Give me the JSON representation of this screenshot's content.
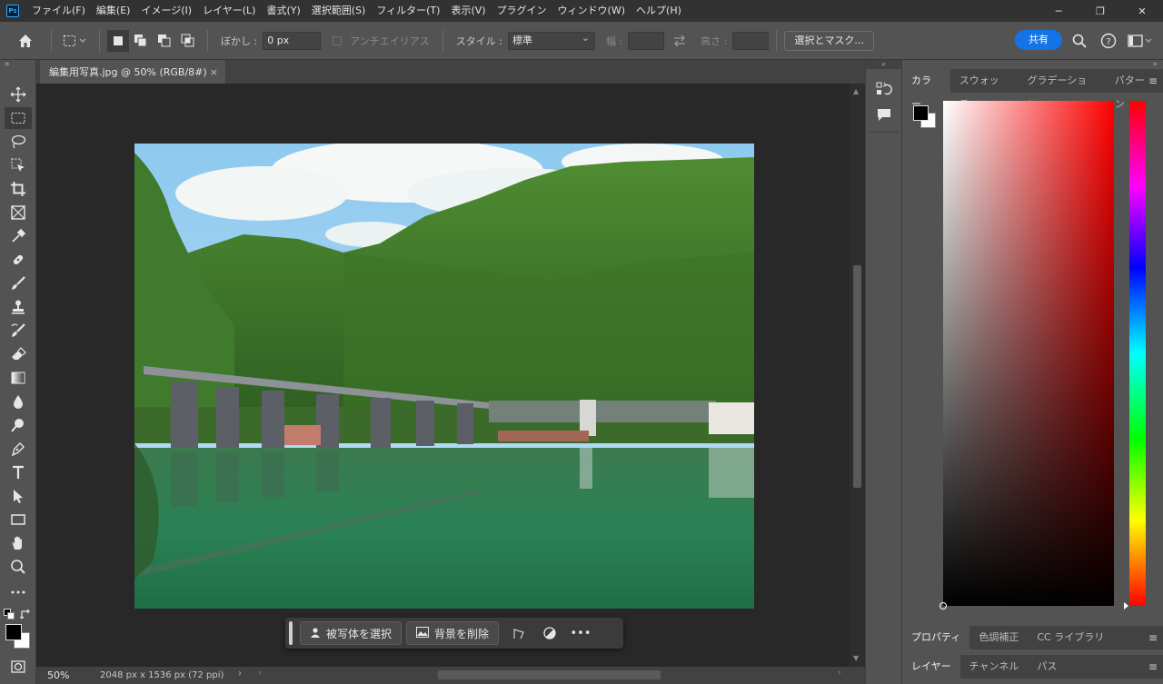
{
  "app": {
    "logo": "Ps"
  },
  "menu": {
    "items": [
      "ファイル(F)",
      "編集(E)",
      "イメージ(I)",
      "レイヤー(L)",
      "書式(Y)",
      "選択範囲(S)",
      "フィルター(T)",
      "表示(V)",
      "プラグイン",
      "ウィンドウ(W)",
      "ヘルプ(H)"
    ]
  },
  "window_controls": {
    "minimize": "─",
    "restore": "❐",
    "close": "✕"
  },
  "options": {
    "feather_label": "ぼかし :",
    "feather_value": "0 px",
    "antialias_label": "アンチエイリアス",
    "style_label": "スタイル :",
    "style_value": "標準",
    "width_label": "幅 :",
    "height_label": "高さ :",
    "select_mask_label": "選択とマスク...",
    "share_label": "共有"
  },
  "document": {
    "tab_title": "編集用写真.jpg @ 50% (RGB/8#)",
    "tab_close": "×",
    "zoom": "50%",
    "info": "2048 px x 1536 px (72 ppi)"
  },
  "context_bar": {
    "select_subject": "被写体を選択",
    "remove_background": "背景を削除",
    "more": "•••"
  },
  "panels": {
    "top_tabs": [
      "カラー",
      "スウォッチ",
      "グラデーション",
      "パターン"
    ],
    "mid_tabs": [
      "プロパティ",
      "色調補正",
      "CC ライブラリ"
    ],
    "bottom_tabs": [
      "レイヤー",
      "チャンネル",
      "パス"
    ],
    "menu_icon": "≡",
    "foreground_color": "#000000",
    "background_color": "#ffffff"
  }
}
